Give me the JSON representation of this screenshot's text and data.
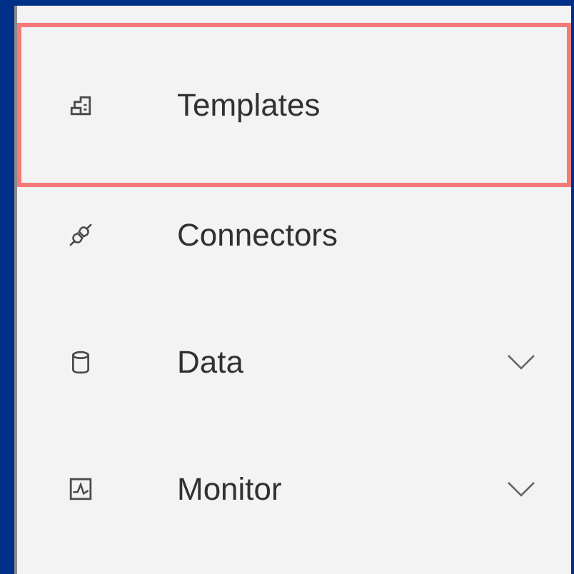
{
  "nav_items": [
    {
      "label": "Templates",
      "highlighted": true,
      "expandable": false
    },
    {
      "label": "Connectors",
      "highlighted": false,
      "expandable": false
    },
    {
      "label": "Data",
      "highlighted": false,
      "expandable": true
    },
    {
      "label": "Monitor",
      "highlighted": false,
      "expandable": true
    }
  ]
}
